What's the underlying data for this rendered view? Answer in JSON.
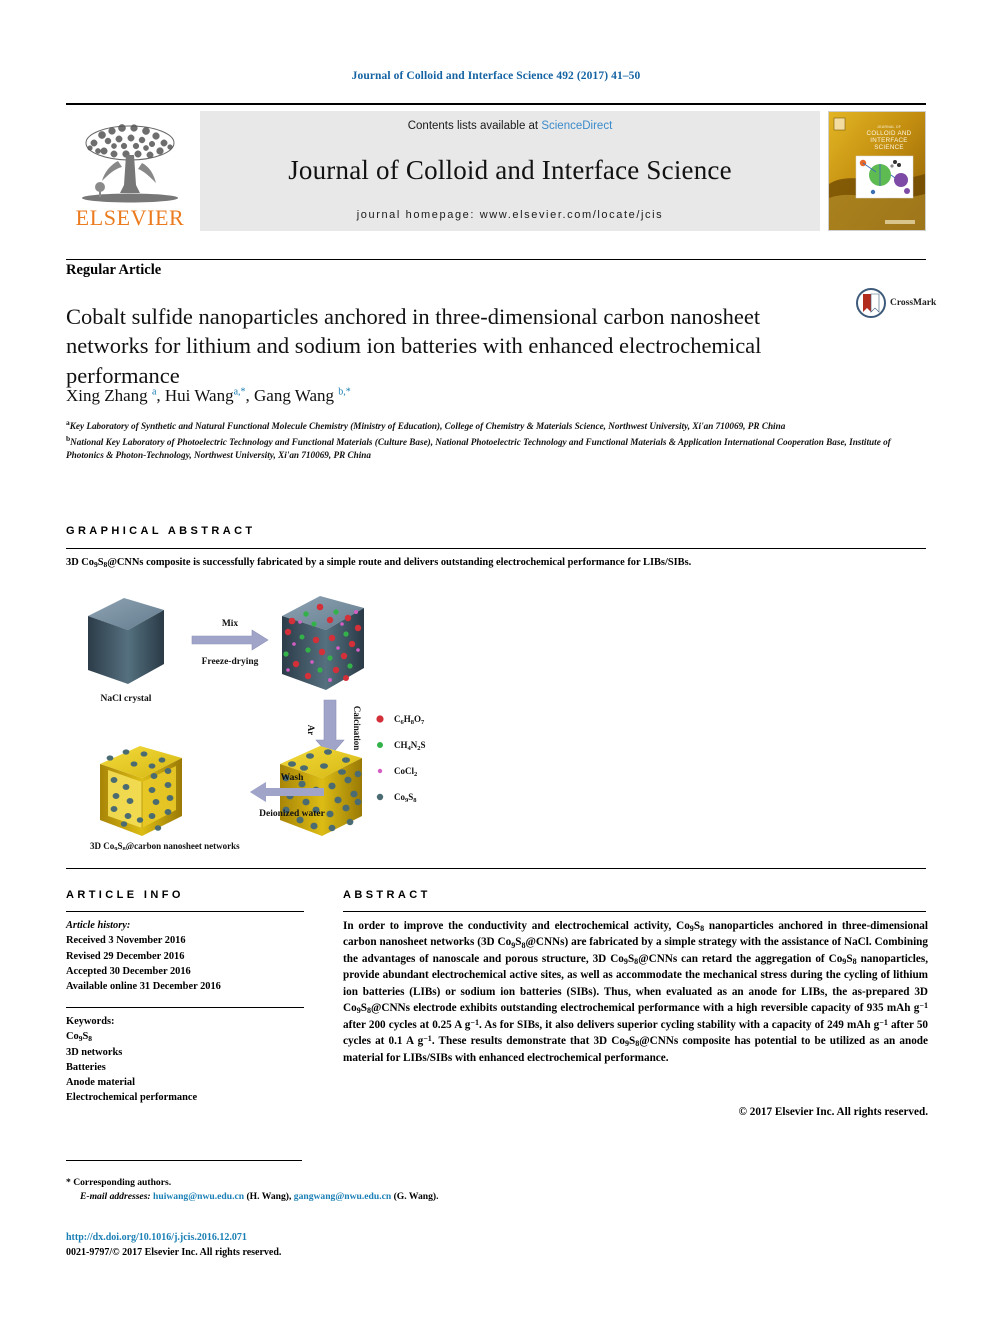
{
  "running_head": "Journal of Colloid and Interface Science 492 (2017) 41–50",
  "masthead": {
    "contents_prefix": "Contents lists available at ",
    "sciencedirect": "ScienceDirect",
    "journal_title": "Journal of Colloid and Interface Science",
    "homepage": "journal homepage: www.elsevier.com/locate/jcis",
    "publisher": "ELSEVIER",
    "cover_title_lines": [
      "COLLOID AND",
      "INTERFACE",
      "SCIENCE"
    ],
    "cover_kicker": "JOURNAL OF",
    "colors": {
      "elsevier_orange": "#eb7b1e",
      "link_blue": "#3b8bcb",
      "running_head_blue": "#1463a3",
      "masthead_gray": "#e8e8e8",
      "cover_gold": "#c8920d"
    }
  },
  "article_type": "Regular Article",
  "title": "Cobalt sulfide nanoparticles anchored in three-dimensional carbon nanosheet networks for lithium and sodium ion batteries with enhanced electrochemical performance",
  "crossmark_label": "CrossMark",
  "authors_html": "Xing Zhang <sup>a</sup>, Hui Wang<sup>a,*</sup>, Gang Wang <sup>b,*</sup>",
  "affiliations": [
    {
      "marker": "a",
      "text": "Key Laboratory of Synthetic and Natural Functional Molecule Chemistry (Ministry of Education), College of Chemistry & Materials Science, Northwest University, Xi'an 710069, PR China"
    },
    {
      "marker": "b",
      "text": "National Key Laboratory of Photoelectric Technology and Functional Materials (Culture Base), National Photoelectric Technology and Functional Materials & Application International Cooperation Base, Institute of Photonics & Photon-Technology, Northwest University, Xi'an 710069, PR China"
    }
  ],
  "graphical_abstract": {
    "heading": "GRAPHICAL ABSTRACT",
    "summary_html": "3D Co<sub>9</sub>S<sub>8</sub>@CNNs composite is successfully fabricated by a simple route and delivers outstanding electrochemical performance for LIBs/SIBs.",
    "figure": {
      "nodes": [
        {
          "id": "nacl",
          "label": "NaCl crystal",
          "color": "#6d8497"
        },
        {
          "id": "precursor",
          "label": "",
          "color": "#5f7486"
        },
        {
          "id": "composite",
          "label": "",
          "color": "#e8c61f"
        },
        {
          "id": "final",
          "label": "3D Co9S8@carbon nanosheet networks",
          "color": "#e8c61f"
        }
      ],
      "arrows": [
        {
          "id": "mix",
          "line1": "Mix",
          "line2": "Freeze-drying",
          "direction": "right"
        },
        {
          "id": "calcination",
          "line1": "Ar",
          "line2": "Calcination",
          "direction": "down"
        },
        {
          "id": "wash",
          "line1": "Wash",
          "line2": "Deionized water",
          "direction": "left"
        }
      ],
      "legend": [
        {
          "formula_html": "C<sub>6</sub>H<sub>8</sub>O<sub>7</sub>",
          "color": "#d3303a",
          "size": 7
        },
        {
          "formula_html": "CH<sub>4</sub>N<sub>2</sub>S",
          "color": "#34b24a",
          "size": 6
        },
        {
          "formula_html": "CoCl<sub>2</sub>",
          "color": "#d45ec4",
          "size": 4
        },
        {
          "formula_html": "Co<sub>9</sub>S<sub>8</sub>",
          "color": "#4b6b73",
          "size": 6
        }
      ],
      "final_caption_html": "3D Co<sub>9</sub>S<sub>8</sub>@carbon nanosheet networks",
      "nacl_caption": "NaCl crystal"
    }
  },
  "article_info": {
    "heading": "ARTICLE INFO",
    "history_label": "Article history:",
    "history": [
      "Received 3 November 2016",
      "Revised 29 December 2016",
      "Accepted 30 December 2016",
      "Available online 31 December 2016"
    ],
    "keywords_label": "Keywords:",
    "keywords_html": [
      "Co<sub>9</sub>S<sub>8</sub>",
      "3D networks",
      "Batteries",
      "Anode material",
      "Electrochemical performance"
    ]
  },
  "abstract": {
    "heading": "ABSTRACT",
    "body_html": "In order to improve the conductivity and electrochemical activity, Co<sub>9</sub>S<sub>8</sub> nanoparticles anchored in three-dimensional carbon nanosheet networks (3D Co<sub>9</sub>S<sub>8</sub>@CNNs) are fabricated by a simple strategy with the assistance of NaCl. Combining the advantages of nanoscale and porous structure, 3D Co<sub>9</sub>S<sub>8</sub>@CNNs can retard the aggregation of Co<sub>9</sub>S<sub>8</sub> nanoparticles, provide abundant electrochemical active sites, as well as accommodate the mechanical stress during the cycling of lithium ion batteries (LIBs) or sodium ion batteries (SIBs). Thus, when evaluated as an anode for LIBs, the as-prepared 3D Co<sub>9</sub>S<sub>8</sub>@CNNs electrode exhibits outstanding electrochemical performance with a high reversible capacity of 935 mAh g<span class=\"supn\">−1</span> after 200 cycles at 0.25 A g<span class=\"supn\">−1</span>. As for SIBs, it also delivers superior cycling stability with a capacity of 249 mAh g<span class=\"supn\">−1</span> after 50 cycles at 0.1 A g<span class=\"supn\">−1</span>. These results demonstrate that 3D Co<sub>9</sub>S<sub>8</sub>@CNNs composite has potential to be utilized as an anode material for LIBs/SIBs with enhanced electrochemical performance.",
    "copyright": "© 2017 Elsevier Inc. All rights reserved."
  },
  "footer": {
    "corresponding_marker": "*",
    "corresponding_text": "Corresponding authors.",
    "email_label": "E-mail addresses:",
    "emails": [
      {
        "address": "huiwang@nwu.edu.cn",
        "person": "(H. Wang)"
      },
      {
        "address": "gangwang@nwu.edu.cn",
        "person": "(G. Wang)"
      }
    ],
    "doi": "http://dx.doi.org/10.1016/j.jcis.2016.12.071",
    "issn_copyright": "0021-9797/© 2017 Elsevier Inc. All rights reserved."
  }
}
